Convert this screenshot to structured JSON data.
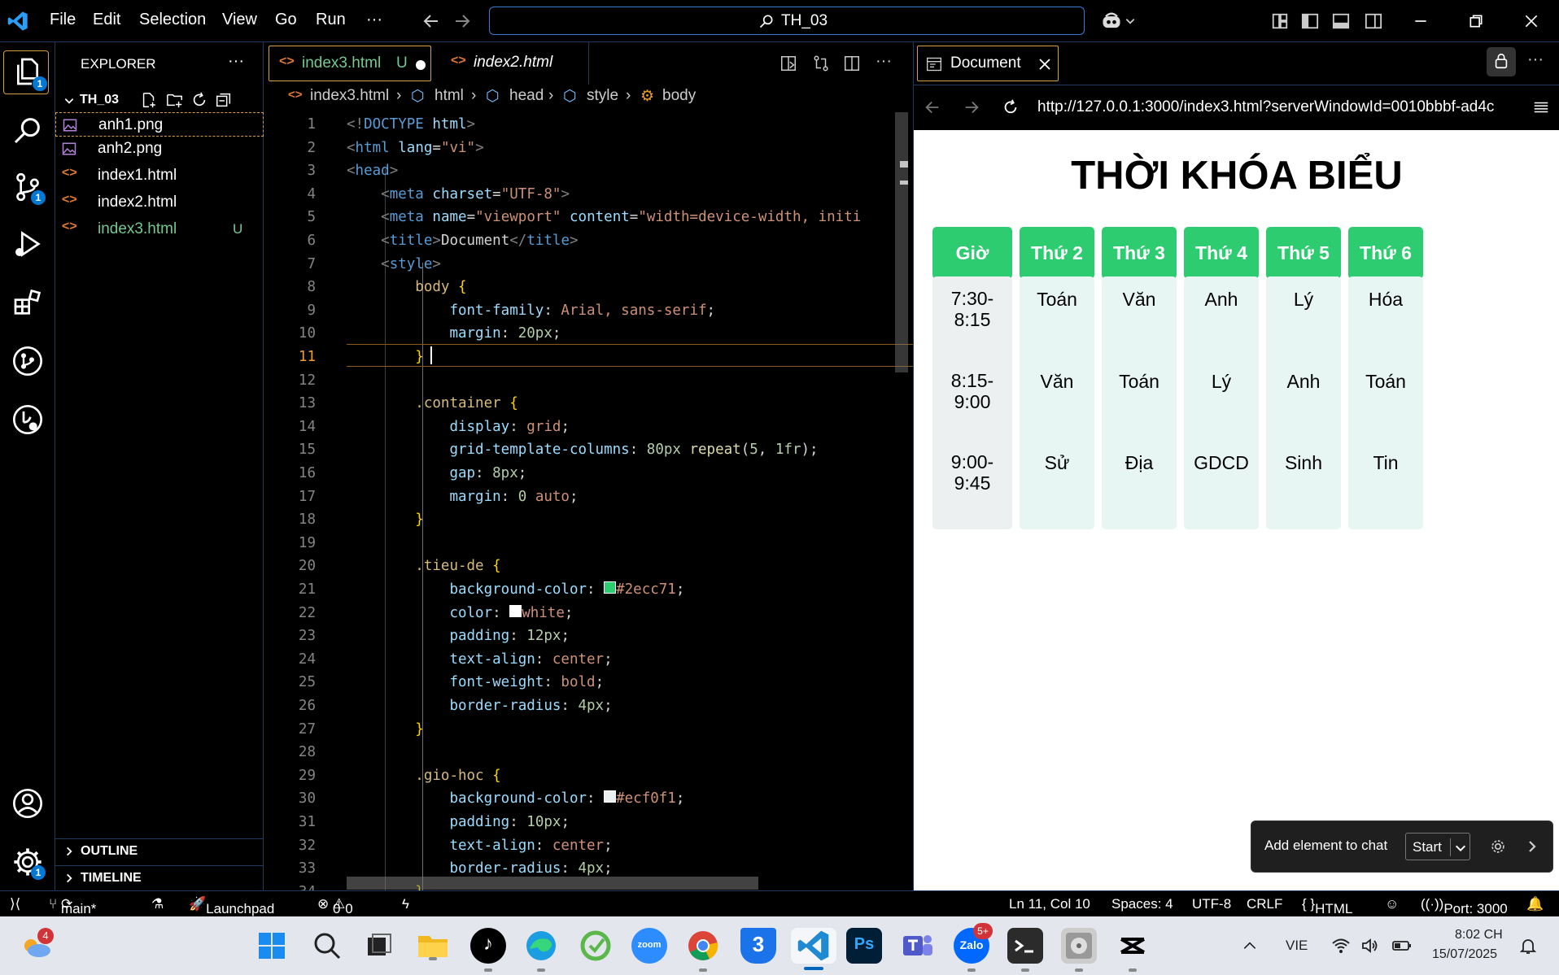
{
  "titlebar": {
    "menu": [
      "File",
      "Edit",
      "Selection",
      "View",
      "Go",
      "Run",
      "···"
    ],
    "search_text": "TH_03"
  },
  "activity": {
    "explorer_badge": "1",
    "scm_badge": "1",
    "settings_badge": "1"
  },
  "explorer": {
    "title": "EXPLORER",
    "more": "···",
    "folder": "TH_03",
    "files": [
      {
        "name": "anh1.png",
        "icon": "image-icon"
      },
      {
        "name": "anh2.png",
        "icon": "image-icon"
      },
      {
        "name": "index1.html",
        "icon": "html-icon"
      },
      {
        "name": "index2.html",
        "icon": "html-icon"
      },
      {
        "name": "index3.html",
        "icon": "html-icon",
        "status": "U"
      }
    ],
    "outline": "OUTLINE",
    "timeline": "TIMELINE"
  },
  "editor": {
    "tabs": [
      {
        "label": "index3.html",
        "status": "U"
      },
      {
        "label": "index2.html"
      }
    ],
    "breadcrumb": [
      "index3.html",
      "html",
      "head",
      "style",
      "body"
    ],
    "current_line": "11"
  },
  "code_lines": [
    {
      "n": "1",
      "html": "<span class='t'>&lt;!</span><span class='k'>DOCTYPE</span> <span class='a'>html</span><span class='t'>&gt;</span>"
    },
    {
      "n": "2",
      "html": "<span class='t'>&lt;</span><span class='k'>html</span> <span class='a'>lang</span>=<span class='s'>\"vi\"</span><span class='t'>&gt;</span>"
    },
    {
      "n": "3",
      "html": "<span class='t'>&lt;</span><span class='k'>head</span><span class='t'>&gt;</span>"
    },
    {
      "n": "4",
      "html": "    <span class='t'>&lt;</span><span class='k'>meta</span> <span class='a'>charset</span>=<span class='s'>\"UTF-8\"</span><span class='t'>&gt;</span>"
    },
    {
      "n": "5",
      "html": "    <span class='t'>&lt;</span><span class='k'>meta</span> <span class='a'>name</span>=<span class='s'>\"viewport\"</span> <span class='a'>content</span>=<span class='s'>\"width=device-width, initi</span>"
    },
    {
      "n": "6",
      "html": "    <span class='t'>&lt;</span><span class='k'>title</span><span class='t'>&gt;</span>Document<span class='t'>&lt;/</span><span class='k'>title</span><span class='t'>&gt;</span>"
    },
    {
      "n": "7",
      "html": "    <span class='t'>&lt;</span><span class='k'>style</span><span class='t'>&gt;</span>"
    },
    {
      "n": "8",
      "html": "        <span class='sel'>body</span> <span class='b'>{</span>"
    },
    {
      "n": "9",
      "html": "            <span class='p'>font-family</span>: <span class='v'>Arial, sans-serif</span>;"
    },
    {
      "n": "10",
      "html": "            <span class='p'>margin</span>: <span class='n'>20px</span>;"
    },
    {
      "n": "11",
      "html": "        <span class='b'>}</span>"
    },
    {
      "n": "12",
      "html": ""
    },
    {
      "n": "13",
      "html": "        <span class='sel'>.container</span> <span class='b'>{</span>"
    },
    {
      "n": "14",
      "html": "            <span class='p'>display</span>: <span class='v'>grid</span>;"
    },
    {
      "n": "15",
      "html": "            <span class='p'>grid-template-columns</span>: <span class='n'>80px</span> <span class='f'>repeat</span>(<span class='n'>5</span>, <span class='n'>1fr</span>);"
    },
    {
      "n": "16",
      "html": "            <span class='p'>gap</span>: <span class='n'>8px</span>;"
    },
    {
      "n": "17",
      "html": "            <span class='p'>margin</span>: <span class='n'>0</span> <span class='v'>auto</span>;"
    },
    {
      "n": "18",
      "html": "        <span class='b'>}</span>"
    },
    {
      "n": "19",
      "html": ""
    },
    {
      "n": "20",
      "html": "        <span class='sel'>.tieu-de</span> <span class='b'>{</span>"
    },
    {
      "n": "21",
      "html": "            <span class='p'>background-color</span>: <span style='display:inline-block;width:13px;height:13px;background:#2ecc71;border:1px solid #fff;'></span><span class='v'>#2ecc71</span>;"
    },
    {
      "n": "22",
      "html": "            <span class='p'>color</span>: <span style='display:inline-block;width:13px;height:13px;background:#fff;border:1px solid #fff;'></span><span class='v'>white</span>;"
    },
    {
      "n": "23",
      "html": "            <span class='p'>padding</span>: <span class='n'>12px</span>;"
    },
    {
      "n": "24",
      "html": "            <span class='p'>text-align</span>: <span class='v'>center</span>;"
    },
    {
      "n": "25",
      "html": "            <span class='p'>font-weight</span>: <span class='v'>bold</span>;"
    },
    {
      "n": "26",
      "html": "            <span class='p'>border-radius</span>: <span class='n'>4px</span>;"
    },
    {
      "n": "27",
      "html": "        <span class='b'>}</span>"
    },
    {
      "n": "28",
      "html": ""
    },
    {
      "n": "29",
      "html": "        <span class='sel'>.gio-hoc</span> <span class='b'>{</span>"
    },
    {
      "n": "30",
      "html": "            <span class='p'>background-color</span>: <span style='display:inline-block;width:13px;height:13px;background:#ecf0f1;border:1px solid #fff;'></span><span class='v'>#ecf0f1</span>;"
    },
    {
      "n": "31",
      "html": "            <span class='p'>padding</span>: <span class='n'>10px</span>;"
    },
    {
      "n": "32",
      "html": "            <span class='p'>text-align</span>: <span class='v'>center</span>;"
    },
    {
      "n": "33",
      "html": "            <span class='p'>border-radius</span>: <span class='n'>4px</span>;"
    },
    {
      "n": "34",
      "html": "        <span class='b'>}</span>"
    }
  ],
  "preview": {
    "tab_label": "Document",
    "url": "http://127.0.0.1:3000/index3.html?serverWindowId=0010bbbf-ad4c",
    "heading": "THỜI KHÓA BIỂU",
    "headers": [
      "Giờ",
      "Thứ 2",
      "Thứ 3",
      "Thứ 4",
      "Thứ 5",
      "Thứ 6"
    ],
    "rows": [
      {
        "time": [
          "7:30-",
          "8:15"
        ],
        "subjects": [
          "Toán",
          "Văn",
          "Anh",
          "Lý",
          "Hóa"
        ]
      },
      {
        "time": [
          "8:15-",
          "9:00"
        ],
        "subjects": [
          "Văn",
          "Toán",
          "Lý",
          "Anh",
          "Toán"
        ]
      },
      {
        "time": [
          "9:00-",
          "9:45"
        ],
        "subjects": [
          "Sử",
          "Địa",
          "GDCD",
          "Sinh",
          "Tin"
        ]
      }
    ],
    "chat_label": "Add element to chat",
    "chat_start": "Start"
  },
  "status": {
    "branch": "main*",
    "launchpad": "Launchpad",
    "errors": "0",
    "warnings": "0",
    "position": "Ln 11, Col 10",
    "spaces": "Spaces: 4",
    "encoding": "UTF-8",
    "eol": "CRLF",
    "language": "HTML",
    "port": "Port: 3000"
  },
  "taskbar": {
    "weather_badge": "4",
    "zalo_badge": "5+",
    "lang": "VIE",
    "time": "8:02 CH",
    "date": "15/07/2025"
  }
}
